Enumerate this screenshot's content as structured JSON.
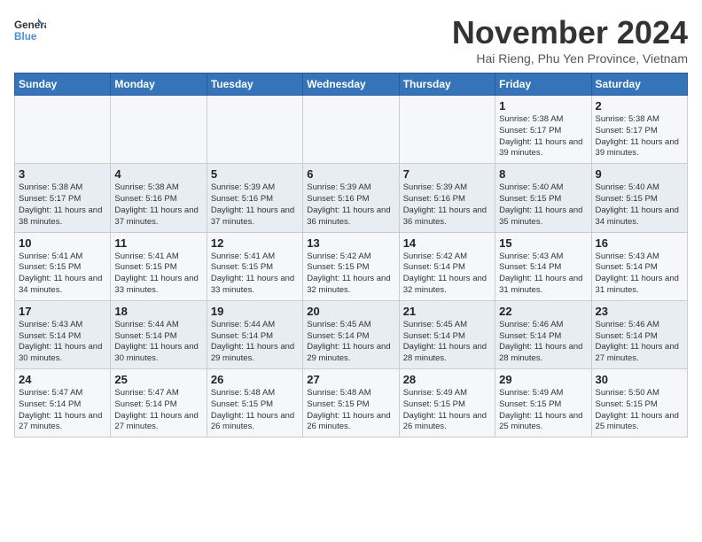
{
  "header": {
    "logo_line1": "General",
    "logo_line2": "Blue",
    "month_title": "November 2024",
    "location": "Hai Rieng, Phu Yen Province, Vietnam"
  },
  "weekdays": [
    "Sunday",
    "Monday",
    "Tuesday",
    "Wednesday",
    "Thursday",
    "Friday",
    "Saturday"
  ],
  "weeks": [
    [
      {
        "day": "",
        "info": ""
      },
      {
        "day": "",
        "info": ""
      },
      {
        "day": "",
        "info": ""
      },
      {
        "day": "",
        "info": ""
      },
      {
        "day": "",
        "info": ""
      },
      {
        "day": "1",
        "info": "Sunrise: 5:38 AM\nSunset: 5:17 PM\nDaylight: 11 hours\nand 39 minutes."
      },
      {
        "day": "2",
        "info": "Sunrise: 5:38 AM\nSunset: 5:17 PM\nDaylight: 11 hours\nand 39 minutes."
      }
    ],
    [
      {
        "day": "3",
        "info": "Sunrise: 5:38 AM\nSunset: 5:17 PM\nDaylight: 11 hours\nand 38 minutes."
      },
      {
        "day": "4",
        "info": "Sunrise: 5:38 AM\nSunset: 5:16 PM\nDaylight: 11 hours\nand 37 minutes."
      },
      {
        "day": "5",
        "info": "Sunrise: 5:39 AM\nSunset: 5:16 PM\nDaylight: 11 hours\nand 37 minutes."
      },
      {
        "day": "6",
        "info": "Sunrise: 5:39 AM\nSunset: 5:16 PM\nDaylight: 11 hours\nand 36 minutes."
      },
      {
        "day": "7",
        "info": "Sunrise: 5:39 AM\nSunset: 5:16 PM\nDaylight: 11 hours\nand 36 minutes."
      },
      {
        "day": "8",
        "info": "Sunrise: 5:40 AM\nSunset: 5:15 PM\nDaylight: 11 hours\nand 35 minutes."
      },
      {
        "day": "9",
        "info": "Sunrise: 5:40 AM\nSunset: 5:15 PM\nDaylight: 11 hours\nand 34 minutes."
      }
    ],
    [
      {
        "day": "10",
        "info": "Sunrise: 5:41 AM\nSunset: 5:15 PM\nDaylight: 11 hours\nand 34 minutes."
      },
      {
        "day": "11",
        "info": "Sunrise: 5:41 AM\nSunset: 5:15 PM\nDaylight: 11 hours\nand 33 minutes."
      },
      {
        "day": "12",
        "info": "Sunrise: 5:41 AM\nSunset: 5:15 PM\nDaylight: 11 hours\nand 33 minutes."
      },
      {
        "day": "13",
        "info": "Sunrise: 5:42 AM\nSunset: 5:15 PM\nDaylight: 11 hours\nand 32 minutes."
      },
      {
        "day": "14",
        "info": "Sunrise: 5:42 AM\nSunset: 5:14 PM\nDaylight: 11 hours\nand 32 minutes."
      },
      {
        "day": "15",
        "info": "Sunrise: 5:43 AM\nSunset: 5:14 PM\nDaylight: 11 hours\nand 31 minutes."
      },
      {
        "day": "16",
        "info": "Sunrise: 5:43 AM\nSunset: 5:14 PM\nDaylight: 11 hours\nand 31 minutes."
      }
    ],
    [
      {
        "day": "17",
        "info": "Sunrise: 5:43 AM\nSunset: 5:14 PM\nDaylight: 11 hours\nand 30 minutes."
      },
      {
        "day": "18",
        "info": "Sunrise: 5:44 AM\nSunset: 5:14 PM\nDaylight: 11 hours\nand 30 minutes."
      },
      {
        "day": "19",
        "info": "Sunrise: 5:44 AM\nSunset: 5:14 PM\nDaylight: 11 hours\nand 29 minutes."
      },
      {
        "day": "20",
        "info": "Sunrise: 5:45 AM\nSunset: 5:14 PM\nDaylight: 11 hours\nand 29 minutes."
      },
      {
        "day": "21",
        "info": "Sunrise: 5:45 AM\nSunset: 5:14 PM\nDaylight: 11 hours\nand 28 minutes."
      },
      {
        "day": "22",
        "info": "Sunrise: 5:46 AM\nSunset: 5:14 PM\nDaylight: 11 hours\nand 28 minutes."
      },
      {
        "day": "23",
        "info": "Sunrise: 5:46 AM\nSunset: 5:14 PM\nDaylight: 11 hours\nand 27 minutes."
      }
    ],
    [
      {
        "day": "24",
        "info": "Sunrise: 5:47 AM\nSunset: 5:14 PM\nDaylight: 11 hours\nand 27 minutes."
      },
      {
        "day": "25",
        "info": "Sunrise: 5:47 AM\nSunset: 5:14 PM\nDaylight: 11 hours\nand 27 minutes."
      },
      {
        "day": "26",
        "info": "Sunrise: 5:48 AM\nSunset: 5:15 PM\nDaylight: 11 hours\nand 26 minutes."
      },
      {
        "day": "27",
        "info": "Sunrise: 5:48 AM\nSunset: 5:15 PM\nDaylight: 11 hours\nand 26 minutes."
      },
      {
        "day": "28",
        "info": "Sunrise: 5:49 AM\nSunset: 5:15 PM\nDaylight: 11 hours\nand 26 minutes."
      },
      {
        "day": "29",
        "info": "Sunrise: 5:49 AM\nSunset: 5:15 PM\nDaylight: 11 hours\nand 25 minutes."
      },
      {
        "day": "30",
        "info": "Sunrise: 5:50 AM\nSunset: 5:15 PM\nDaylight: 11 hours\nand 25 minutes."
      }
    ]
  ]
}
